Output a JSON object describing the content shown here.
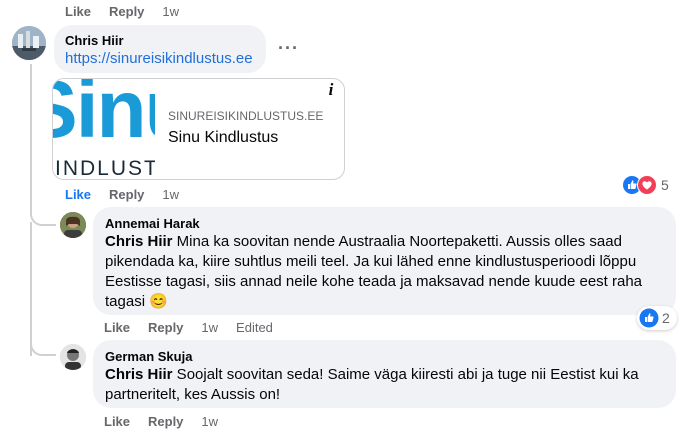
{
  "top_actions": {
    "like": "Like",
    "reply": "Reply",
    "time": "1w"
  },
  "comments": [
    {
      "author": "Chris Hiir",
      "link": "https://sinureisikindlustus.ee",
      "more": "···",
      "preview": {
        "thumb_text_top": "Sinu",
        "thumb_text_bottom": "INDLUSTI",
        "domain": "SINUREISIKINDLUSTUS.EE",
        "title": "Sinu Kindlustus",
        "info": "i"
      },
      "actions": {
        "like": "Like",
        "reply": "Reply",
        "time": "1w"
      },
      "reactions": {
        "count": "5"
      }
    },
    {
      "author": "Annemai Harak",
      "mention": "Chris Hiir",
      "text": " Mina ka soovitan nende Austraalia Noortepaketti. Aussis olles saad pikendada ka, kiire suhtlus meili teel. Ja kui lähed enne kindlustusperioodi lõppu Eestisse tagasi, siis annad neile kohe teada ja maksavad nende kuude eest raha tagasi ",
      "emoji": "😊",
      "actions": {
        "like": "Like",
        "reply": "Reply",
        "time": "1w",
        "edited": "Edited"
      },
      "reactions": {
        "count": "2"
      }
    },
    {
      "author": "German Skuja",
      "mention": "Chris Hiir",
      "text": " Soojalt soovitan seda! Saime väga kiiresti abi ja tuge nii Eestist kui ka partneritelt, kes Aussis on!",
      "actions": {
        "like": "Like",
        "reply": "Reply",
        "time": "1w"
      }
    }
  ],
  "colors": {
    "like_blue": "#1877f2",
    "love_red": "#f33e58",
    "link": "#216fdb",
    "bubble": "#f0f2f5",
    "meta": "#65676b"
  }
}
